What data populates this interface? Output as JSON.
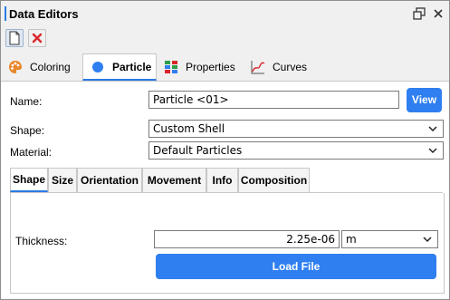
{
  "window": {
    "title": "Data Editors"
  },
  "main_tabs": [
    {
      "label": "Coloring",
      "icon": "palette-icon"
    },
    {
      "label": "Particle",
      "icon": "particle-dot-icon"
    },
    {
      "label": "Properties",
      "icon": "properties-grid-icon"
    },
    {
      "label": "Curves",
      "icon": "curve-chart-icon"
    }
  ],
  "active_main_tab": "Particle",
  "form": {
    "name_label": "Name:",
    "name_value": "Particle <01>",
    "view_button": "View",
    "shape_label": "Shape:",
    "shape_value": "Custom Shell",
    "material_label": "Material:",
    "material_value": "Default Particles"
  },
  "sub_tabs": [
    "Shape",
    "Size",
    "Orientation",
    "Movement",
    "Info",
    "Composition"
  ],
  "active_sub_tab": "Shape",
  "shape_panel": {
    "thickness_label": "Thickness:",
    "thickness_value": "2.25e-06",
    "unit_value": "m",
    "load_button": "Load File"
  },
  "colors": {
    "accent": "#2f7ff0",
    "delete_red": "#d9262b",
    "tab_underline": "#2a7ae4"
  }
}
